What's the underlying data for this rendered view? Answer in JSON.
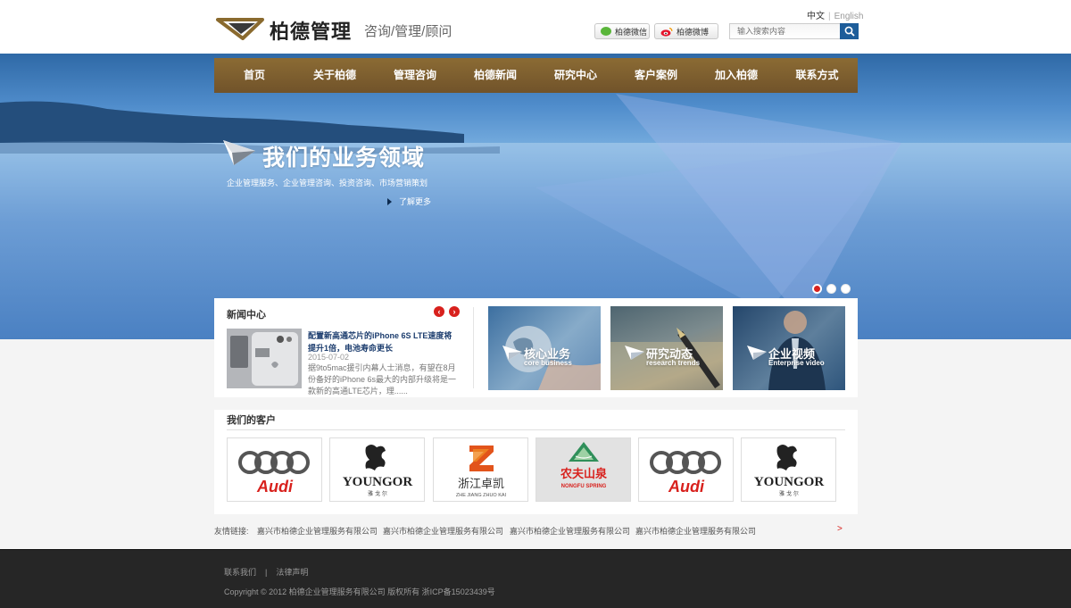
{
  "header": {
    "brand": "柏德管理",
    "slogan": "咨询/管理/顾问",
    "lang_zh": "中文",
    "lang_en": "English",
    "wechat_label": "柏德微信",
    "weibo_label": "柏德微博",
    "search_placeholder": "输入搜索内容"
  },
  "nav": [
    "首页",
    "关于柏德",
    "管理咨询",
    "柏德新闻",
    "研究中心",
    "客户案例",
    "加入柏德",
    "联系方式"
  ],
  "hero": {
    "title": "我们的业务领域",
    "subtitle": "企业管理服务、企业管理咨询、投资咨询、市场营销策划",
    "more": "了解更多",
    "slides": 3,
    "active_slide": 1
  },
  "news": {
    "section_title": "新闻中心",
    "headline": "配置新高通芯片的iPhone 6S LTE速度将提升1倍，电池寿命更长",
    "date": "2015-07-02",
    "body": "据9to5mac援引内幕人士消息，有望在8月份备好的iPhone 6s最大的内部升级将是一款新的高通LTE芯片，理......"
  },
  "features": [
    {
      "title": "核心业务",
      "subtitle": "core business"
    },
    {
      "title": "研究动态",
      "subtitle": "research trends"
    },
    {
      "title": "企业视频",
      "subtitle": "Enterprise video"
    }
  ],
  "clients": {
    "title": "我们的客户",
    "logos": [
      {
        "name": "Audi",
        "text": "Audi"
      },
      {
        "name": "Youngor",
        "text": "YOUNGOR",
        "sub": "雅 戈 尔"
      },
      {
        "name": "Zhejiang Zhuokai",
        "text": "浙江卓凯",
        "sub": "ZHE JIANG ZHUO KAI"
      },
      {
        "name": "Nongfu Spring",
        "text": "农夫山泉",
        "sub": "NONGFU SPRING"
      },
      {
        "name": "Audi",
        "text": "Audi"
      },
      {
        "name": "Youngor",
        "text": "YOUNGOR",
        "sub": "雅 戈 尔"
      }
    ]
  },
  "links": {
    "label": "友情链接:",
    "items": [
      "嘉兴市柏德企业管理服务有限公司",
      "嘉兴市柏德企业管理服务有限公司",
      "嘉兴市柏德企业管理服务有限公司",
      "嘉兴市柏德企业管理服务有限公司"
    ],
    "more": ">"
  },
  "footer": {
    "contact": "联系我们",
    "separator": "|",
    "legal": "法律声明",
    "copyright": "Copyright © 2012 柏德企业管理服务有限公司 版权所有 浙ICP备15023439号"
  },
  "colors": {
    "nav_bg": "#7f6030",
    "accent_red": "#d8211d",
    "search_button": "#1d5d9a",
    "footer_bg": "#262626"
  }
}
